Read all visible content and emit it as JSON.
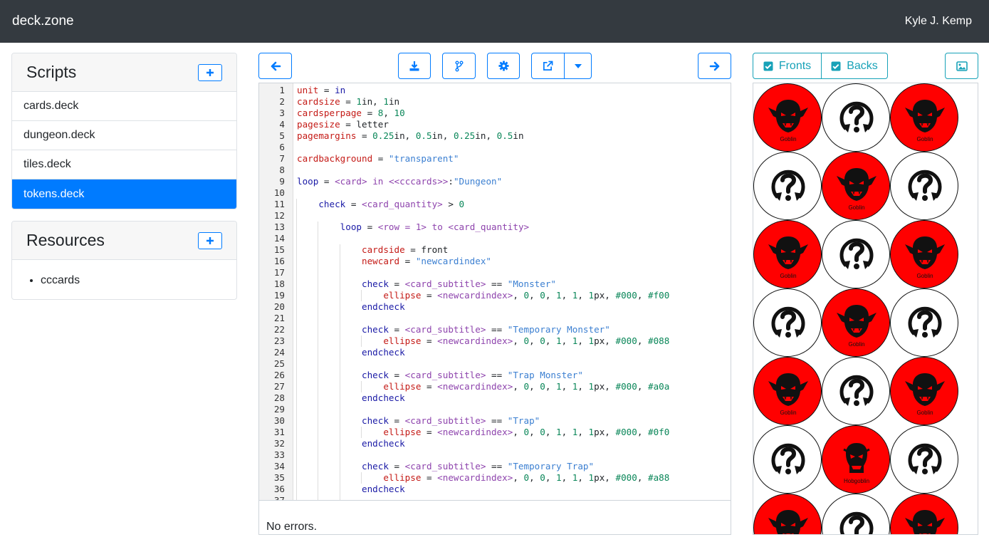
{
  "navbar": {
    "brand": "deck.zone",
    "user": "Kyle J. Kemp"
  },
  "scripts": {
    "title": "Scripts",
    "items": [
      "cards.deck",
      "dungeon.deck",
      "tiles.deck",
      "tokens.deck"
    ],
    "active_index": 3
  },
  "resources": {
    "title": "Resources",
    "items": [
      "cccards"
    ]
  },
  "toolbar": {
    "icons": [
      "arrow-left-icon",
      "download-icon",
      "fork-icon",
      "gear-icon",
      "external-link-icon",
      "caret-down-icon",
      "arrow-right-icon",
      "image-icon"
    ],
    "fronts_label": "Fronts",
    "backs_label": "Backs",
    "fronts_checked": true,
    "backs_checked": true
  },
  "editor": {
    "lines": [
      "unit = in",
      "cardsize = 1in, 1in",
      "cardsperpage = 8, 10",
      "pagesize = letter",
      "pagemargins = 0.25in, 0.5in, 0.25in, 0.5in",
      "",
      "cardbackground = \"transparent\"",
      "",
      "loop = <card> in <<cccards>>:\"Dungeon\"",
      "",
      "    check = <card_quantity> > 0",
      "",
      "        loop = <row = 1> to <card_quantity>",
      "",
      "            cardside = front",
      "            newcard = \"newcardindex\"",
      "",
      "            check = <card_subtitle> == \"Monster\"",
      "                ellipse = <newcardindex>, 0, 0, 1, 1, 1px, #000, #f00",
      "            endcheck",
      "",
      "            check = <card_subtitle> == \"Temporary Monster\"",
      "                ellipse = <newcardindex>, 0, 0, 1, 1, 1px, #000, #088",
      "            endcheck",
      "",
      "            check = <card_subtitle> == \"Trap Monster\"",
      "                ellipse = <newcardindex>, 0, 0, 1, 1, 1px, #000, #a0a",
      "            endcheck",
      "",
      "            check = <card_subtitle> == \"Trap\"",
      "                ellipse = <newcardindex>, 0, 0, 1, 1, 1px, #000, #0f0",
      "            endcheck",
      "",
      "            check = <card_subtitle> == \"Temporary Trap\"",
      "                ellipse = <newcardindex>, 0, 0, 1, 1, 1px, #000, #a88",
      "            endcheck",
      ""
    ],
    "status": "No errors."
  },
  "preview": {
    "tokens": [
      {
        "kind": "goblin",
        "label": "Goblin"
      },
      {
        "kind": "unknown",
        "label": ""
      },
      {
        "kind": "goblin",
        "label": "Goblin"
      },
      {
        "kind": "unknown",
        "label": ""
      },
      {
        "kind": "goblin",
        "label": "Goblin"
      },
      {
        "kind": "unknown",
        "label": ""
      },
      {
        "kind": "goblin",
        "label": "Goblin"
      },
      {
        "kind": "unknown",
        "label": ""
      },
      {
        "kind": "goblin",
        "label": "Goblin"
      },
      {
        "kind": "unknown",
        "label": ""
      },
      {
        "kind": "goblin",
        "label": "Goblin"
      },
      {
        "kind": "unknown",
        "label": ""
      },
      {
        "kind": "goblin",
        "label": "Goblin"
      },
      {
        "kind": "unknown",
        "label": ""
      },
      {
        "kind": "goblin",
        "label": "Goblin"
      },
      {
        "kind": "unknown",
        "label": ""
      },
      {
        "kind": "hobgoblin",
        "label": "Hobgoblin"
      },
      {
        "kind": "unknown",
        "label": ""
      },
      {
        "kind": "goblin",
        "label": ""
      },
      {
        "kind": "unknown",
        "label": ""
      },
      {
        "kind": "goblin",
        "label": ""
      }
    ]
  },
  "colors": {
    "navbar": "#343a40",
    "primary": "#007bff",
    "info": "#17a2b8",
    "token_red": "#ff0000"
  }
}
